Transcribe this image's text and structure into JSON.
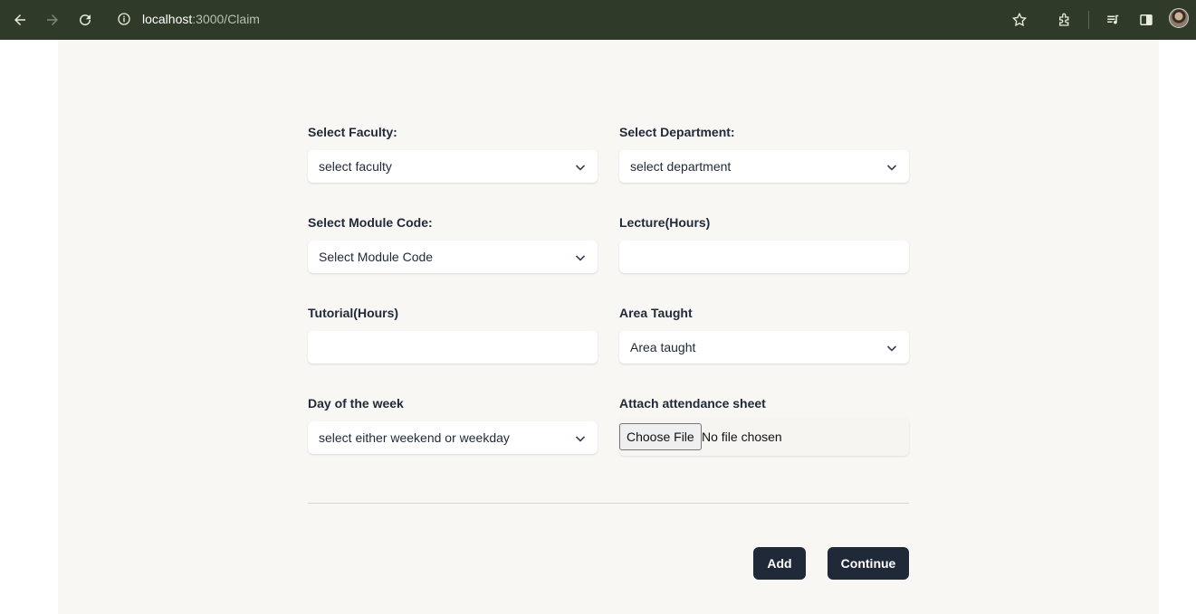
{
  "browser": {
    "url_host": "localhost",
    "url_path": ":3000/Claim",
    "icons": [
      "back-icon",
      "forward-icon",
      "reload-icon",
      "info-icon",
      "star-icon",
      "extensions-icon",
      "media-icon",
      "sidepanel-icon",
      "profile-avatar"
    ]
  },
  "form": {
    "faculty": {
      "label": "Select Faculty:",
      "value": "select faculty"
    },
    "department": {
      "label": "Select Department:",
      "value": "select department"
    },
    "module_code": {
      "label": "Select Module Code:",
      "value": "Select Module Code"
    },
    "lecture_hours": {
      "label": "Lecture(Hours)",
      "value": ""
    },
    "tutorial_hours": {
      "label": "Tutorial(Hours)",
      "value": ""
    },
    "area_taught": {
      "label": "Area Taught",
      "value": "Area taught"
    },
    "day_of_week": {
      "label": "Day of the week",
      "value": "select either weekend or weekday"
    },
    "attendance": {
      "label": "Attach attendance sheet",
      "button": "Choose File",
      "status": "No file chosen"
    }
  },
  "actions": {
    "add_label": "Add",
    "continue_label": "Continue"
  },
  "colors": {
    "toolbar_bg": "#2f3a29",
    "page_bg": "#f9f7f4",
    "button_bg": "#1f2937"
  }
}
